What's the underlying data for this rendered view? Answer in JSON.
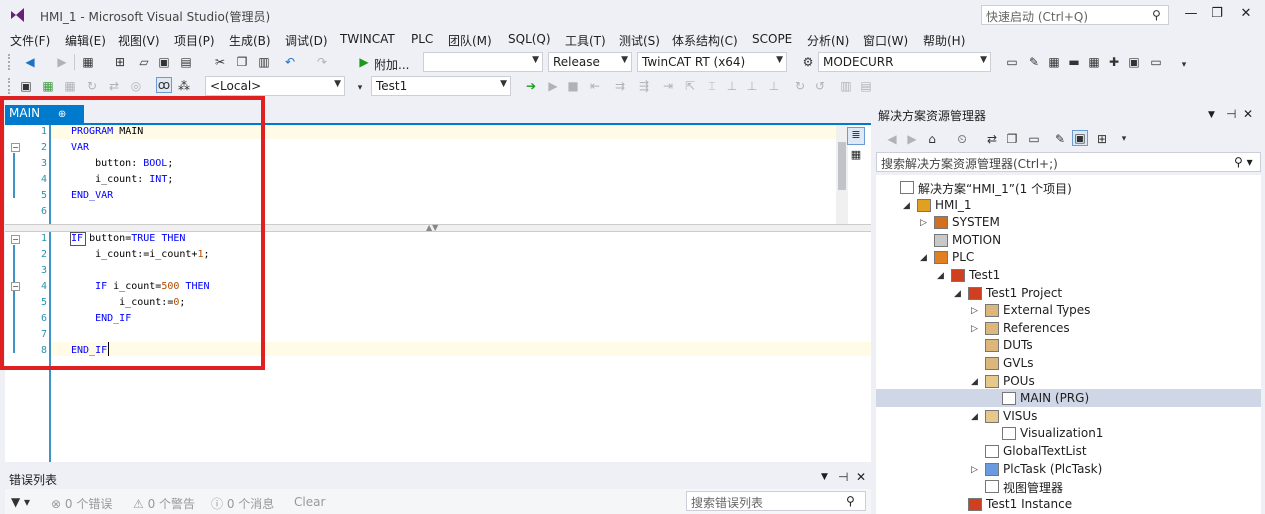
{
  "window": {
    "title": "HMI_1 - Microsoft Visual Studio(管理员)",
    "quick_launch_placeholder": "快速启动 (Ctrl+Q)"
  },
  "menu": [
    "文件(F)",
    "编辑(E)",
    "视图(V)",
    "项目(P)",
    "生成(B)",
    "调试(D)",
    "TWINCAT",
    "PLC",
    "团队(M)",
    "SQL(Q)",
    "工具(T)",
    "测试(S)",
    "体系结构(C)",
    "SCOPE",
    "分析(N)",
    "窗口(W)",
    "帮助(H)"
  ],
  "toolbar": {
    "attach_label": "附加...",
    "config_value": "Release",
    "platform_value": "TwinCAT RT (x64)",
    "target_value": "MODECURR",
    "local_value": "<Local>",
    "project_value": "Test1"
  },
  "editor": {
    "tab_label": "MAIN",
    "decl_lines": [
      {
        "n": "1",
        "text": "PROGRAM MAIN"
      },
      {
        "n": "2",
        "text": "VAR"
      },
      {
        "n": "3",
        "text": "    button: BOOL;"
      },
      {
        "n": "4",
        "text": "    i_count: INT;"
      },
      {
        "n": "5",
        "text": "END_VAR"
      },
      {
        "n": "6",
        "text": ""
      }
    ],
    "impl_lines": [
      {
        "n": "1",
        "text": "IF button=TRUE THEN"
      },
      {
        "n": "2",
        "text": "    i_count:=i_count+1;"
      },
      {
        "n": "3",
        "text": ""
      },
      {
        "n": "4",
        "text": "    IF i_count=500 THEN"
      },
      {
        "n": "5",
        "text": "        i_count:=0;"
      },
      {
        "n": "6",
        "text": "    END_IF"
      },
      {
        "n": "7",
        "text": ""
      },
      {
        "n": "8",
        "text": "END_IF"
      }
    ]
  },
  "error_list": {
    "title": "错误列表",
    "errors": "0 个错误",
    "warnings": "0 个警告",
    "messages": "0 个消息",
    "clear": "Clear",
    "search_placeholder": "搜索错误列表"
  },
  "solution_explorer": {
    "title": "解决方案资源管理器",
    "search_placeholder": "搜索解决方案资源管理器(Ctrl+;)",
    "tree": [
      {
        "label": "解决方案“HMI_1”(1 个项目)",
        "level": 0,
        "arrow": "",
        "icon": "solution-icon"
      },
      {
        "label": "HMI_1",
        "level": 1,
        "arrow": "◢",
        "icon": "project-icon"
      },
      {
        "label": "SYSTEM",
        "level": 2,
        "arrow": "▷",
        "icon": "system-icon"
      },
      {
        "label": "MOTION",
        "level": 2,
        "arrow": "",
        "icon": "motion-icon"
      },
      {
        "label": "PLC",
        "level": 2,
        "arrow": "◢",
        "icon": "plc-icon"
      },
      {
        "label": "Test1",
        "level": 3,
        "arrow": "◢",
        "icon": "plc-project-icon"
      },
      {
        "label": "Test1 Project",
        "level": 4,
        "arrow": "◢",
        "icon": "plc-project-icon"
      },
      {
        "label": "External Types",
        "level": 5,
        "arrow": "▷",
        "icon": "folder-icon"
      },
      {
        "label": "References",
        "level": 5,
        "arrow": "▷",
        "icon": "references-icon"
      },
      {
        "label": "DUTs",
        "level": 5,
        "arrow": "",
        "icon": "folder-icon"
      },
      {
        "label": "GVLs",
        "level": 5,
        "arrow": "",
        "icon": "folder-icon"
      },
      {
        "label": "POUs",
        "level": 5,
        "arrow": "◢",
        "icon": "folder-open-icon"
      },
      {
        "label": "MAIN (PRG)",
        "level": 6,
        "arrow": "",
        "icon": "pou-icon"
      },
      {
        "label": "VISUs",
        "level": 5,
        "arrow": "◢",
        "icon": "folder-open-icon"
      },
      {
        "label": "Visualization1",
        "level": 6,
        "arrow": "",
        "icon": "visu-icon"
      },
      {
        "label": "GlobalTextList",
        "level": 5,
        "arrow": "",
        "icon": "textlist-icon"
      },
      {
        "label": "PlcTask (PlcTask)",
        "level": 5,
        "arrow": "▷",
        "icon": "task-icon"
      },
      {
        "label": "视图管理器",
        "level": 5,
        "arrow": "",
        "icon": "view-manager-icon"
      },
      {
        "label": "Test1 Instance",
        "level": 4,
        "arrow": "",
        "icon": "instance-icon"
      }
    ]
  }
}
